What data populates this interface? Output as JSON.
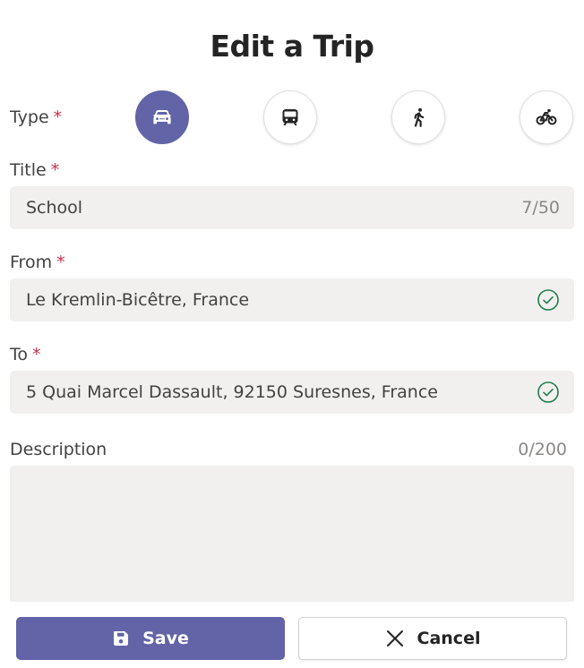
{
  "page": {
    "title": "Edit a Trip"
  },
  "type": {
    "label": "Type",
    "required_mark": "*",
    "options": [
      {
        "icon": "car-icon",
        "selected": true
      },
      {
        "icon": "train-icon",
        "selected": false
      },
      {
        "icon": "walk-icon",
        "selected": false
      },
      {
        "icon": "bike-icon",
        "selected": false
      }
    ]
  },
  "title_field": {
    "label": "Title",
    "required_mark": "*",
    "value": "School",
    "counter": "7/50"
  },
  "from_field": {
    "label": "From",
    "required_mark": "*",
    "value": "Le Kremlin-Bicêtre, France",
    "validated": true
  },
  "to_field": {
    "label": "To",
    "required_mark": "*",
    "value": "5 Quai Marcel Dassault, 92150 Suresnes, France",
    "validated": true
  },
  "description": {
    "label": "Description",
    "counter": "0/200",
    "value": ""
  },
  "actions": {
    "save_label": "Save",
    "cancel_label": "Cancel"
  },
  "colors": {
    "accent": "#6264a7",
    "required": "#c4314b",
    "success": "#237b4b",
    "field_bg": "#f1f0ef"
  }
}
